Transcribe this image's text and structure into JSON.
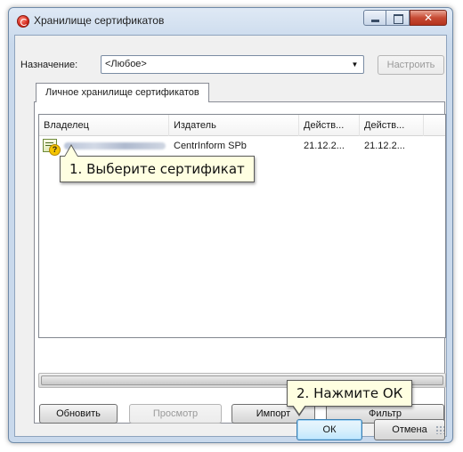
{
  "window": {
    "title": "Хранилище сертификатов"
  },
  "purpose": {
    "label": "Назначение:",
    "selected": "<Любое>",
    "configure_button": "Настроить"
  },
  "tab": {
    "label": "Личное хранилище сертификатов"
  },
  "table": {
    "columns": [
      "Владелец",
      "Издатель",
      "Действ...",
      "Действ..."
    ],
    "rows": [
      {
        "issuer": "CentrInform SPb",
        "valid_from": "21.12.2...",
        "valid_to": "21.12.2..."
      }
    ]
  },
  "buttons": {
    "refresh": "Обновить",
    "view": "Просмотр",
    "import": "Импорт",
    "filter": "Фильтр",
    "ok": "ОК",
    "cancel": "Отмена"
  },
  "callouts": {
    "select_cert": "1. Выберите сертификат",
    "press_ok": "2. Нажмите ОК"
  },
  "colors": {
    "callout_bg": "#ffffe1",
    "titlebar": "#c9d9ec",
    "close_button": "#c74b34"
  }
}
